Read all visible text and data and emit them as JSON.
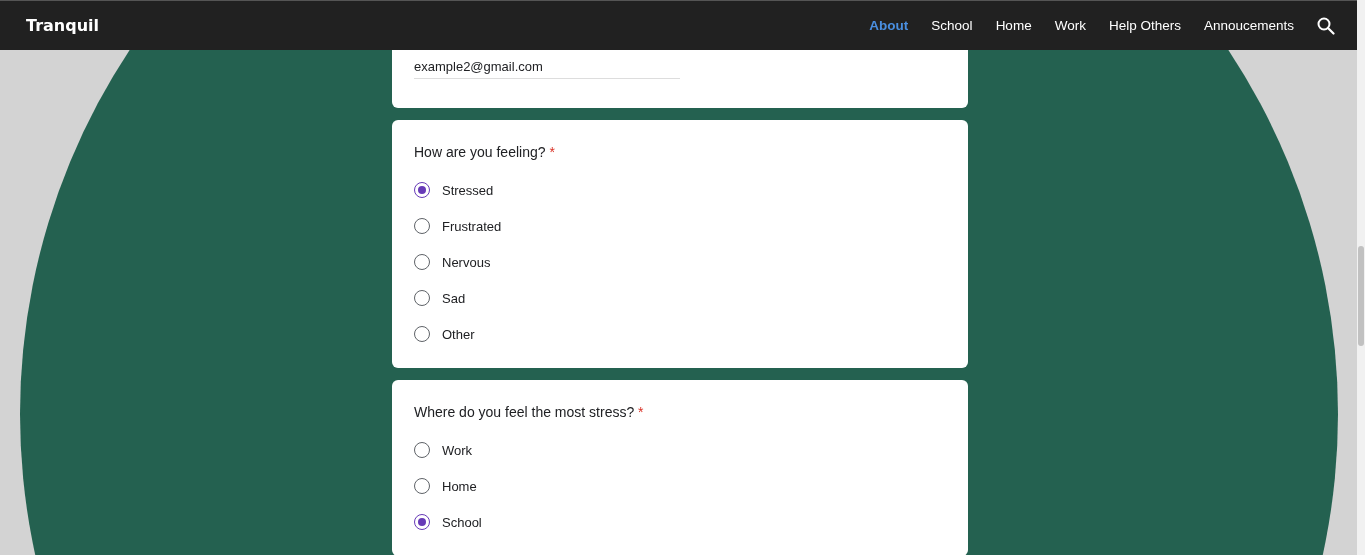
{
  "navbar": {
    "brand": "Tranquil",
    "links": [
      {
        "label": "About",
        "selected": true
      },
      {
        "label": "School",
        "selected": false
      },
      {
        "label": "Home",
        "selected": false
      },
      {
        "label": "Work",
        "selected": false
      },
      {
        "label": "Help Others",
        "selected": false
      },
      {
        "label": "Annoucements",
        "selected": false
      }
    ]
  },
  "email_card": {
    "value": "example2@gmail.com"
  },
  "questions": [
    {
      "label": "How are you feeling?",
      "required": "*",
      "options": [
        {
          "label": "Stressed",
          "selected": true
        },
        {
          "label": "Frustrated",
          "selected": false
        },
        {
          "label": "Nervous",
          "selected": false
        },
        {
          "label": "Sad",
          "selected": false
        },
        {
          "label": "Other",
          "selected": false
        }
      ]
    },
    {
      "label": "Where do you feel the most stress?",
      "required": "*",
      "options": [
        {
          "label": "Work",
          "selected": false
        },
        {
          "label": "Home",
          "selected": false
        },
        {
          "label": "School",
          "selected": true
        }
      ]
    }
  ]
}
